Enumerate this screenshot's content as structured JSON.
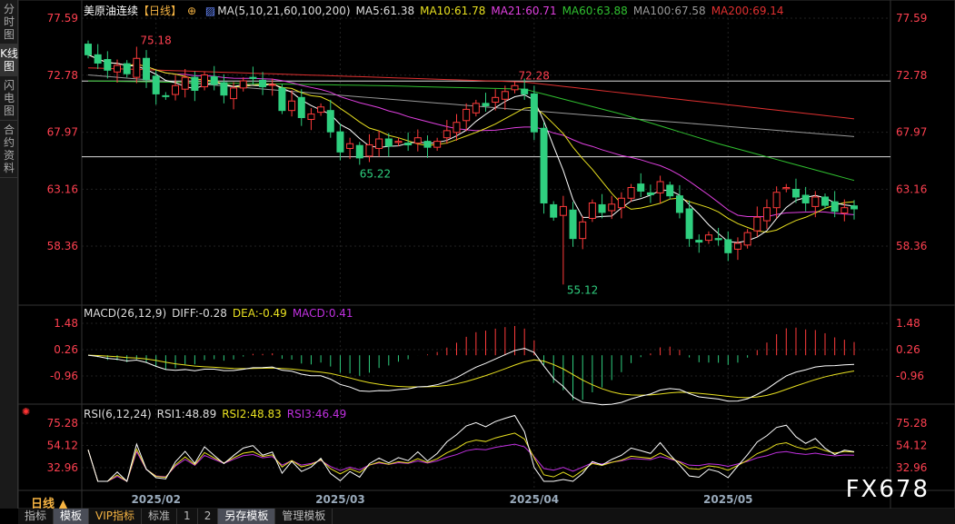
{
  "sidebar": {
    "tabs": [
      "分时图",
      "K线图",
      "闪电图",
      "合约资料"
    ],
    "active": 1
  },
  "header": {
    "symbol": "美原油连续",
    "period_tag": "【日线】",
    "ma_label": "MA(5,10,21,60,100,200)",
    "ma5": "MA5:61.38",
    "ma10": "MA10:61.78",
    "ma21": "MA21:60.71",
    "ma60": "MA60:63.88",
    "ma100": "MA100:67.58",
    "ma200": "MA200:69.14"
  },
  "macd": {
    "label": "MACD(26,12,9)",
    "diff": "DIFF:-0.28",
    "dea": "DEA:-0.49",
    "macd": "MACD:0.41",
    "ticks": [
      "1.48",
      "0.26",
      "-0.96"
    ]
  },
  "rsi": {
    "label": "RSI(6,12,24)",
    "rsi1": "RSI1:48.89",
    "rsi2": "RSI2:48.83",
    "rsi3": "RSI3:46.49",
    "ticks": [
      "75.28",
      "54.12",
      "32.96"
    ]
  },
  "price_ticks": [
    "77.59",
    "72.78",
    "67.97",
    "63.16",
    "58.36"
  ],
  "annotations": {
    "high1": "75.18",
    "high2": "72.28",
    "low1": "65.22",
    "low2": "55.12"
  },
  "period": "日线 ▲",
  "bottom_tabs": [
    "指标",
    "模板",
    "VIP指标",
    "标准",
    "1",
    "2",
    "另存模板",
    "管理模板"
  ],
  "bottom_selected": [
    1,
    6
  ],
  "logo": "FX678",
  "colors": {
    "up": "#ff3b3b",
    "down": "#2fcf7f",
    "ma5": "#ffffff",
    "ma10": "#e8e020",
    "ma21": "#e040e0",
    "ma60": "#30c030",
    "ma100": "#999999",
    "ma200": "#e03030",
    "axis": "#ff4050"
  },
  "chart_data": {
    "type": "candlestick",
    "date_labels": [
      "2025/02",
      "2025/03",
      "2025/04",
      "2025/05"
    ],
    "date_label_index": [
      7,
      26,
      46,
      66
    ],
    "closes": [
      74.5,
      73.8,
      73.2,
      73.6,
      72.9,
      74.2,
      72.4,
      71.2,
      71.0,
      71.9,
      72.6,
      71.5,
      72.8,
      72.0,
      71.1,
      71.7,
      72.3,
      72.5,
      71.8,
      72.0,
      69.8,
      70.6,
      69.2,
      69.5,
      70.1,
      68.0,
      66.3,
      67.0,
      65.8,
      66.9,
      67.4,
      66.8,
      67.2,
      66.9,
      67.5,
      66.7,
      67.2,
      68.1,
      68.8,
      69.9,
      70.4,
      70.2,
      70.9,
      71.4,
      71.9,
      71.2,
      68.0,
      62.0,
      60.8,
      61.7,
      59.0,
      60.4,
      62.0,
      61.2,
      61.9,
      62.4,
      63.3,
      63.0,
      62.7,
      63.8,
      62.6,
      61.2,
      59.0,
      58.7,
      59.3,
      58.9,
      57.8,
      58.6,
      59.5,
      60.8,
      61.6,
      62.9,
      63.3,
      62.5,
      62.0,
      62.5,
      61.8,
      61.3,
      61.6,
      61.5
    ],
    "first_open": 75.4,
    "extremes": [
      {
        "index": 5,
        "high": 75.18
      },
      {
        "index": 44,
        "high": 72.28
      },
      {
        "index": 28,
        "low": 65.22
      },
      {
        "index": 49,
        "low": 55.12
      }
    ],
    "horizontal_levels": [
      72.28,
      65.9
    ],
    "ma60_points": [
      [
        0,
        72.3
      ],
      [
        30,
        71.9
      ],
      [
        45,
        71.6
      ],
      [
        55,
        69.5
      ],
      [
        65,
        67.0
      ],
      [
        79,
        63.9
      ]
    ],
    "ma100_points": [
      [
        0,
        72.8
      ],
      [
        79,
        67.6
      ]
    ],
    "ma200_points": [
      [
        0,
        73.4
      ],
      [
        45,
        72.2
      ],
      [
        79,
        69.1
      ]
    ],
    "price_range": [
      58.36,
      77.59
    ]
  }
}
